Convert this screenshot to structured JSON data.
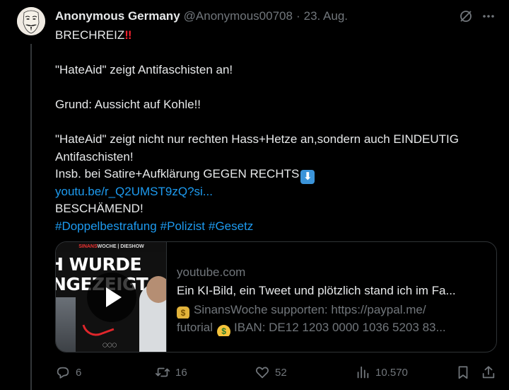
{
  "tweet": {
    "display_name": "Anonymous Germany",
    "handle": "@Anonymous00708",
    "separator": "·",
    "date": "23. Aug.",
    "lines": {
      "l1": "BRECHREIZ",
      "l1_emoji": "‼",
      "l2": "\"HateAid\" zeigt Antifaschisten an!",
      "l3": "Grund: Aussicht auf Kohle!!",
      "l4": "\"HateAid\" zeigt nicht nur rechten Hass+Hetze an,sondern auch EINDEUTIG",
      "l5": "Antifaschisten!",
      "l6": "Insb. bei Satire+Aufklärung GEGEN RECHTS",
      "l6_emoji": "⬇",
      "link": "youtu.be/r_Q2UMST9zQ?si...",
      "l7": "BESCHÄMEND!"
    },
    "hashtags": [
      "#Doppelbestrafung",
      "#Polizist",
      "#Gesetz"
    ]
  },
  "card": {
    "thumb_header_red": "SINANS",
    "thumb_header_rest": "WOCHE | DIESHOW",
    "thumb_line1": "H WURDE",
    "thumb_line2": "NGEZEIGT",
    "domain": "youtube.com",
    "title": "Ein KI-Bild, ein Tweet und plötzlich stand ich im Fa...",
    "desc_line1": "SinansWoche supporten: https://paypal.me/",
    "desc_line2_a": "futorial",
    "desc_line2_b": "IBAN: DE12 1203 0000 1036 5203 83..."
  },
  "actions": {
    "replies": "6",
    "reposts": "16",
    "likes": "52",
    "views": "10.570"
  },
  "colors": {
    "background": "#000000",
    "text": "#e7e9ea",
    "muted": "#71767b",
    "link": "#1d9bf0",
    "border": "#2f3336"
  },
  "icons": [
    "grok-icon",
    "more-icon",
    "reply-icon",
    "repost-icon",
    "like-icon",
    "views-icon",
    "bookmark-icon",
    "share-icon",
    "play-icon",
    "moneybag-emoji",
    "money-face-emoji"
  ]
}
